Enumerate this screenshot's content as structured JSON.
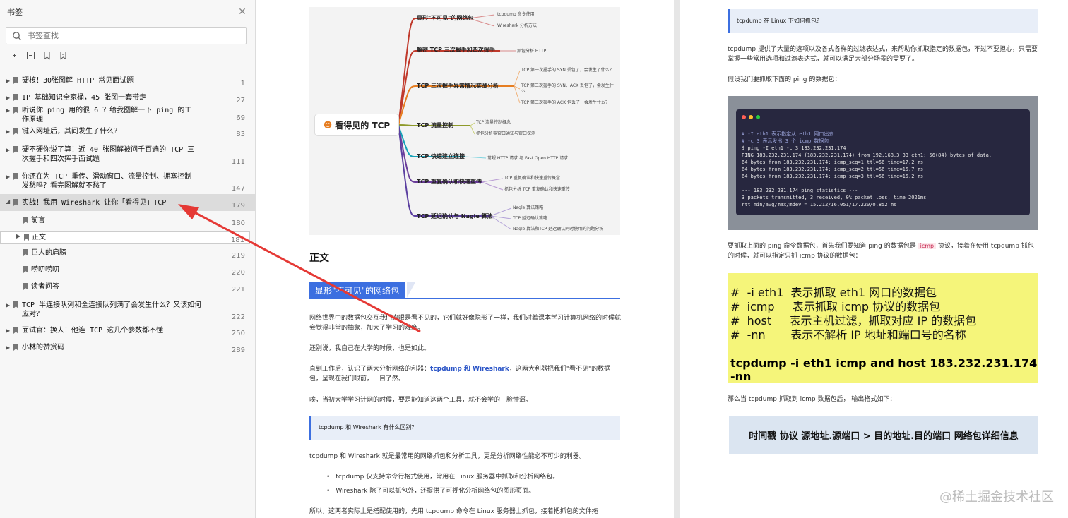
{
  "sidebar": {
    "title": "书签",
    "search_placeholder": "书签查找",
    "items": [
      {
        "label": "硬核！30张图解 HTTP 常见面试题",
        "page": "1"
      },
      {
        "label": "IP 基础知识全家桶，45 张图一套带走",
        "page": "27"
      },
      {
        "label": "听说你 ping 用的很 6 ？给我图解一下 ping 的工作原理",
        "page": "69"
      },
      {
        "label": "键入网址后，其间发生了什么？",
        "page": "83"
      },
      {
        "label": "硬不硬你说了算！近 40 张图解被问千百遍的 TCP 三次握手和四次挥手面试题",
        "page": "111"
      },
      {
        "label": "你还在为 TCP 重传、滑动窗口、流量控制、拥塞控制发愁吗？看完图解就不愁了",
        "page": "147"
      },
      {
        "label": "实战！我用 Wireshark 让你「看得见」TCP",
        "page": "179"
      },
      {
        "label": "前言",
        "page": "180"
      },
      {
        "label": "正文",
        "page": "181"
      },
      {
        "label": "巨人的肩膀",
        "page": "219"
      },
      {
        "label": "唠叨唠叨",
        "page": "220"
      },
      {
        "label": "读者问答",
        "page": "221"
      },
      {
        "label": "TCP 半连接队列和全连接队列满了会发生什么？又该如何应对？",
        "page": "222"
      },
      {
        "label": "面试官：换人！他连 TCP 这几个参数都不懂",
        "page": "250"
      },
      {
        "label": "小林的赞赏码",
        "page": "289"
      }
    ]
  },
  "mindmap": {
    "center": "看得见的 TCP",
    "branches": [
      {
        "label": "显形\"不可见\"的网络包",
        "leaves": [
          "tcpdump 命令使用",
          "Wireshark 分析方法"
        ]
      },
      {
        "label": "解密 TCP 三次握手和四次挥手",
        "leaves": [
          "抓包分析 HTTP"
        ]
      },
      {
        "label": "TCP 三次握手异常情况实战分析",
        "leaves": [
          "TCP 第一次握手的 SYN 丢包了，会发生了什么？",
          "TCP 第二次握手的 SYN、ACK 丢包了，会发生什么",
          "TCP 第三次握手的 ACK 包丢了，会发生什么？"
        ]
      },
      {
        "label": "TCP 流量控制",
        "leaves": [
          "TCP 流量控制概念",
          "抓包分析零窗口通知与窗口探测"
        ]
      },
      {
        "label": "TCP 快速建立连接",
        "leaves": [
          "常规 HTTP 请求 与 Fast Open HTTP 请求"
        ]
      },
      {
        "label": "TCP 重复确认和快速重传",
        "leaves": [
          "TCP 重复确认和快速重传概念",
          "抓包分析 TCP 重复确认和快速重传"
        ]
      },
      {
        "label": "TCP 延迟确认与 Nagle 算法",
        "leaves": [
          "Nagle 算法策略",
          "TCP 延迟确认策略",
          "Nagle 算法和TCP 延迟确认同时使用的问题分析"
        ]
      }
    ]
  },
  "middle": {
    "heading": "正文",
    "section_title": "显形\"不可见\"的网络包",
    "p1": "网络世界中的数据包交互我们肉眼是看不见的，它们就好像隐形了一样，我们对着课本学习计算机网络的时候就会觉得非常的抽象，加大了学习的难度。",
    "p2": "还别说，我自己在大学的时候，也是如此。",
    "p3_a": "直到工作后，认识了两大分析网络的利器：",
    "p3_hl": "tcpdump 和 Wireshark",
    "p3_b": "，这两大利器把我们\"看不见\"的数据包，呈现在我们眼前，一目了然。",
    "p4": "唉，当初大学学习计网的时候，要是能知道这两个工具，就不会学的一脸懵逼。",
    "quote": "tcpdump 和 Wireshark 有什么区别？",
    "p5": "tcpdump 和 Wireshark 就是最常用的网络抓包和分析工具，更是分析网络性能必不可少的利器。",
    "bullets": [
      "tcpdump 仅支持命令行格式使用，常用在 Linux 服务器中抓取和分析网络包。",
      "Wireshark 除了可以抓包外，还提供了可视化分析网络包的图形页面。"
    ],
    "p6": "所以，这两者实际上是搭配使用的，先用 tcpdump 命令在 Linux 服务器上抓包，接着把抓包的文件拖"
  },
  "right": {
    "quote": "tcpdump 在 Linux 下如何抓包？",
    "p1": "tcpdump 提供了大量的选项以及各式各样的过滤表达式，来帮助你抓取指定的数据包，不过不要担心，只需要掌握一些常用选项和过滤表达式，就可以满足大部分场景的需要了。",
    "p2": "假设我们要抓取下面的 ping 的数据包：",
    "terminal": [
      "# -I eth1 表示指定从 eth1 网口出去",
      "# -c 3   表示发出 3 个 icmp 数据包",
      "$ ping -I eth1 -c 3 183.232.231.174",
      "PING 183.232.231.174 (183.232.231.174) from 192.168.3.33 eth1: 56(84) bytes of data.",
      "64 bytes from 183.232.231.174: icmp_seq=1 ttl=56 time=17.2 ms",
      "64 bytes from 183.232.231.174: icmp_seq=2 ttl=56 time=15.7 ms",
      "64 bytes from 183.232.231.174: icmp_seq=3 ttl=56 time=15.2 ms",
      "",
      "--- 183.232.231.174 ping statistics ---",
      "3 packets transmitted, 3 received, 0% packet loss, time 2021ms",
      "rtt min/avg/max/mdev = 15.212/16.051/17.220/0.852 ms"
    ],
    "p3_a": "要抓取上面的 ping 命令数据包，首先我们要知道 ping 的数据包是",
    "p3_code": "icmp",
    "p3_b": "协议，接着在使用 tcpdump 抓包的时候，就可以指定只抓 icmp 协议的数据包：",
    "yellow_lines": [
      "#  -i eth1  表示抓取 eth1 网口的数据包",
      "#  icmp     表示抓取 icmp 协议的数据包",
      "#  host     表示主机过滤，抓取对应 IP 的数据包",
      "#  -nn       表示不解析 IP 地址和端口号的名称"
    ],
    "yellow_cmd": "tcpdump -i eth1 icmp and host 183.232.231.174 -nn",
    "p4": "那么当 tcpdump 抓取到 icmp 数据包后， 输出格式如下：",
    "format": "时间戳 协议 源地址.源端口 > 目的地址.目的端口 网络包详细信息",
    "watermark": "@稀土掘金技术社区"
  }
}
